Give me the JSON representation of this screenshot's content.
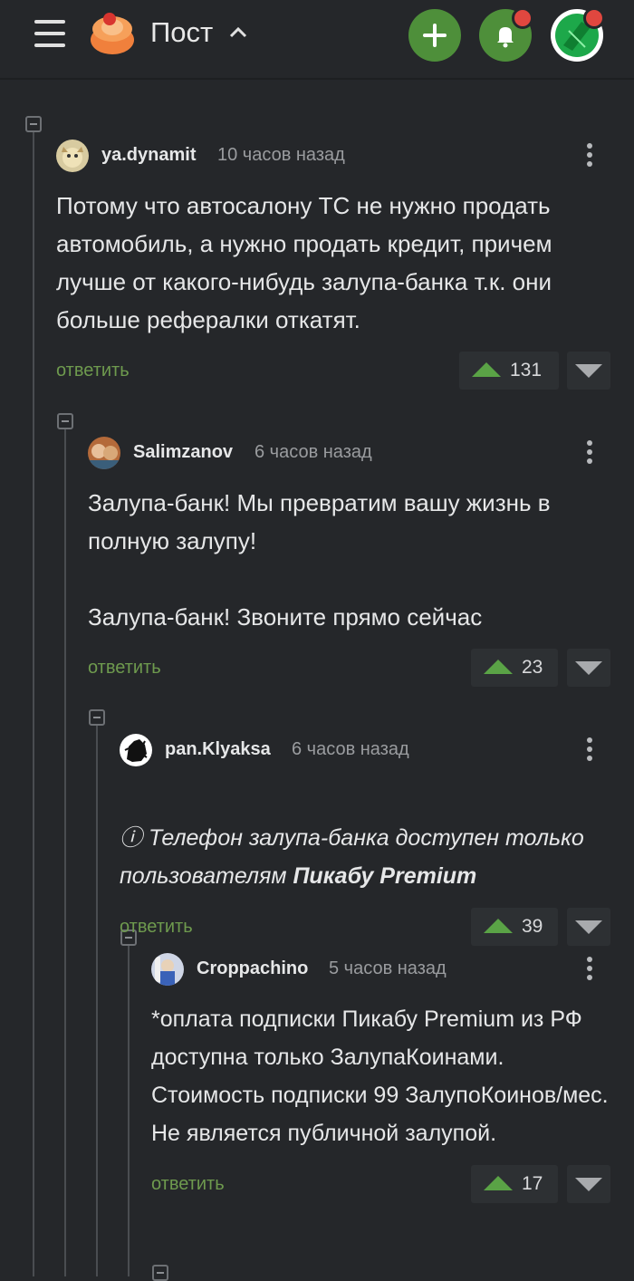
{
  "header": {
    "title": "Пост"
  },
  "comments": [
    {
      "user": "ya.dynamit",
      "time": "10 часов назад",
      "text": "Потому что автосалону ТС не нужно продать автомобиль, а нужно продать кредит, причем лучше от какого-нибудь залупа-банка т.к. они больше рефералки откатят.",
      "reply": "ответить",
      "score": "131"
    },
    {
      "user": "Salimzanov",
      "time": "6 часов назад",
      "text": "Залупа-банк! Мы превратим вашу жизнь в полную залупу!\n\nЗалупа-банк! Звоните прямо сейчас",
      "reply": "ответить",
      "score": "23"
    },
    {
      "user": "pan.Klyaksa",
      "time": "6 часов назад",
      "text_prefix": "ⓘ Телефон залупа-банка доступен только пользователям ",
      "text_bold": "Пикабу Premium",
      "reply": "ответить",
      "score": "39"
    },
    {
      "user": "Croppachino",
      "time": "5 часов назад",
      "text": "*оплата подписки Пикабу Premium из РФ доступна только ЗалупаКоинами. Стоимость подписки 99 ЗалупоКоинов/мес. Не является публичной залупой.",
      "reply": "ответить",
      "score": "17"
    }
  ],
  "colors": {
    "background": "#25272a",
    "accent_green": "#4e8f3a",
    "upvote": "#5aa346",
    "reply": "#6e9a4e",
    "badge": "#e0473f"
  },
  "icons": [
    "menu-icon",
    "pikabu-logo",
    "chevron-up-icon",
    "plus-icon",
    "bell-icon",
    "user-avatar",
    "more-vertical-icon",
    "upvote-icon",
    "downvote-icon",
    "collapse-icon"
  ]
}
